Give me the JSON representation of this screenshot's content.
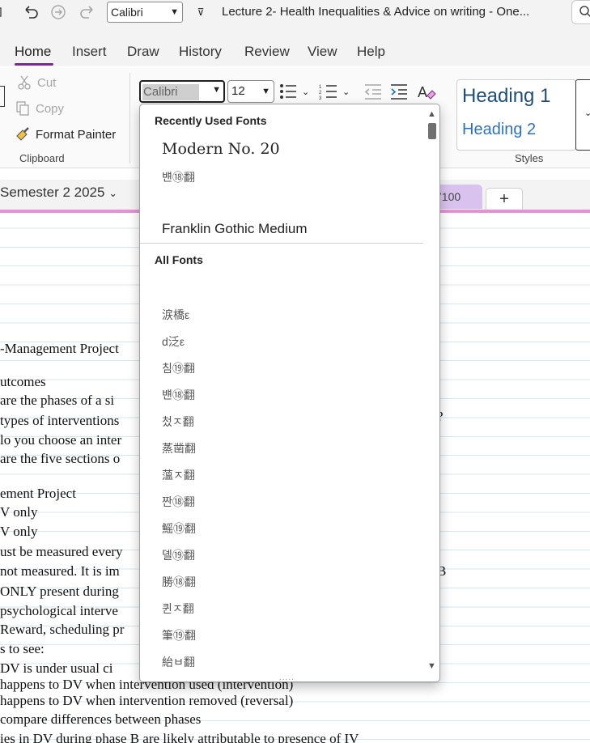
{
  "titlebar": {
    "font_name": "Calibri",
    "doc_title": "Lecture 2- Health Inequalities & Advice on writing  -  One..."
  },
  "tabs": [
    "Home",
    "Insert",
    "Draw",
    "History",
    "Review",
    "View",
    "Help"
  ],
  "ribbon": {
    "clipboard": {
      "cut": "Cut",
      "copy": "Copy",
      "format_painter": "Format Painter",
      "label": "Clipboard"
    },
    "font_name": "Calibri",
    "font_size": "12",
    "styles": {
      "heading1": "Heading 1",
      "heading2": "Heading 2",
      "label": "Styles"
    }
  },
  "section": {
    "notebook": "Semester 2 2025",
    "page_tab": "7100",
    "add": "+"
  },
  "page_lines": [
    "-Management Project",
    "utcomes",
    " are the phases of a si",
    " types of interventions",
    "lo you choose an inter",
    " are the five sections o",
    "ement Project",
    "V only",
    "V only",
    "ust be measured every",
    "not measured. It is im",
    "ONLY present during",
    "psychological interve",
    "Reward, scheduling pr",
    "s to see:",
    "DV is under usual ci",
    " happens to DV when intervention used (intervention)",
    " happens to DV when intervention removed (reversal)",
    "compare differences between phases",
    "ies in DV during phase B are likely attributable to presence of IV"
  ],
  "page_right_fragments": {
    "r1": "?",
    "r2": "B"
  },
  "dropdown": {
    "recent_header": "Recently Used Fonts",
    "recent": [
      "Modern No. 20",
      "뱬⑱翻",
      "Franklin Gothic Medium"
    ],
    "all_header": "All Fonts",
    "all": [
      "涙橋ε",
      "d泛ε",
      "침⑲翻",
      "뱬⑱翻",
      "첬ㅈ翻",
      "蒸凿翻",
      "薀ㅈ翻",
      "짠⑱翻",
      "鰩⑲翻",
      "뎰⑲翻",
      "勝⑱翻",
      "퀸ㅈ翻",
      "筆⑲翻",
      "紿ㅂ翻"
    ]
  },
  "colors": {
    "accent": "#7b2b8b",
    "section_rule": "#e88fd8",
    "page_tab": "#d9c2ee",
    "heading1": "#1f4e79",
    "heading2": "#2e74b5"
  }
}
